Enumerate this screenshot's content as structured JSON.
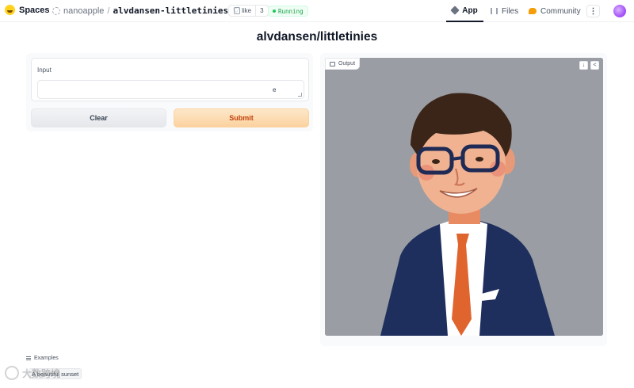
{
  "header": {
    "brand": "Spaces",
    "repo_owner": "nanoapple",
    "repo_separator": "/",
    "repo_name": "alvdansen-littletinies",
    "like_label": "like",
    "like_count": "3",
    "status": "Running",
    "nav": {
      "app": "App",
      "files": "Files",
      "community": "Community"
    },
    "menu_glyph": "⋮"
  },
  "page_title": "alvdansen/littletinies",
  "input": {
    "label": "Input",
    "value": "e"
  },
  "buttons": {
    "clear": "Clear",
    "submit": "Submit"
  },
  "output": {
    "label": "Output",
    "download_glyph": "↓",
    "share_glyph": "<"
  },
  "examples": {
    "label": "Examples",
    "items": [
      "A beautiful sunset"
    ]
  },
  "watermark": "大数跨境",
  "colors": {
    "accent": "#f97316",
    "submit_bg": "#fbd29f",
    "status_green": "#22c55e",
    "image_bg": "#9a9da3"
  }
}
